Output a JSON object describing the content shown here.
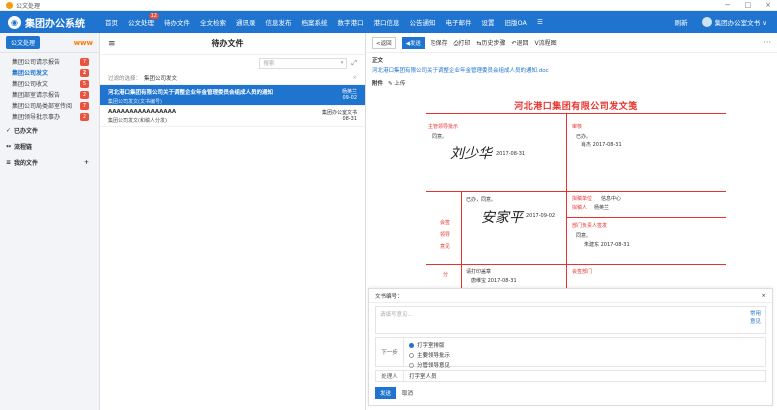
{
  "window": {
    "title": "公文处理",
    "minimize": "−",
    "maximize": "□",
    "close": "×"
  },
  "brand": {
    "name": "集团办公系统"
  },
  "nav": {
    "items": [
      "首页",
      "公文处理",
      "待办文件",
      "全文检索",
      "通讯录",
      "信息发布",
      "档案系统",
      "数字港口",
      "港口信息",
      "公告通知",
      "电子邮件",
      "设置",
      "旧版OA",
      "☰"
    ],
    "badge": "12",
    "refresh": "刷新",
    "user": "集团办公室文书 ∨"
  },
  "sidebar": {
    "pill": "公文处理",
    "watermark": "www",
    "items": [
      {
        "label": "集团公司请示报告",
        "count": "7"
      },
      {
        "label": "集团公司发文",
        "count": "2"
      },
      {
        "label": "集团公司收文",
        "count": "5"
      },
      {
        "label": "集团部室请示报告",
        "count": "2"
      },
      {
        "label": "集团公司局类部室传阅",
        "count": "7"
      },
      {
        "label": "集团领导批示事办",
        "count": "2"
      }
    ],
    "groups": [
      {
        "icon": "✓",
        "label": "已办文件",
        "extra": ""
      },
      {
        "icon": "↔",
        "label": "流程链",
        "extra": ""
      },
      {
        "icon": "≡",
        "label": "我的文件",
        "extra": "+"
      }
    ]
  },
  "list": {
    "menu_icon": "≡",
    "title": "待办文件",
    "search_placeholder": "搜索",
    "expand": "⤢",
    "filter_label": "过滤的选择：",
    "filter_value": "集团公司发文",
    "filter_close": "×",
    "rows": [
      {
        "title": "河北港口集团有限公司关于调整企业年金管理委员会组成人员的通知",
        "sub": "集团公司发文(文书编号)",
        "right1": "杨英兰",
        "right2": "09-02"
      },
      {
        "title": "AAAAAAAAAAAAAAAA",
        "sub": "集团公司发文(和稿人分发)",
        "right1": "集团办公室文书",
        "right2": "08-31"
      }
    ]
  },
  "detail": {
    "toolbar": {
      "back": "<返回",
      "send": "◀发送",
      "save": "⎘保存",
      "print": "⎙打印",
      "history": "⇆历史步骤",
      "return": "↶退回",
      "flow": "Ⅴ流程图",
      "more": "···"
    },
    "section": "正文",
    "doc_link": "河北港口集团有限公司关于调整企业年金管理委员会组成人员的通知.doc",
    "attach_label": "附件",
    "upload": "✎ 上传",
    "doc": {
      "title": "河北港口集团有限公司发文笺",
      "c1_label": "主管领导批示",
      "c1_text": "同意。",
      "c1_sig": "刘少华",
      "c1_date": "2017-08-31",
      "c2_label": "审核",
      "c2_text": "已办。",
      "c2_date": "肖杰 2017-08-31",
      "c3_text": "已办，同意。",
      "c3_sig": "安家平",
      "c3_date": "2017-09-02",
      "c3_side1": "会签",
      "c3_side2": "领导",
      "c3_side3": "意见",
      "c4_label": "拟稿单位",
      "c4_val": "信息中心",
      "c4_label2": "拟稿人",
      "c4_val2": "杨英兰",
      "c5_label": "部门负责人签发",
      "c5_text": "同意。",
      "c5_date": "朱建东 2017-08-31",
      "c6_side": "分",
      "c6_text": "请打印盖章",
      "c6_date": "唐维宝 2017-08-31",
      "c7_label": "会签部门"
    }
  },
  "panel": {
    "title": "文书编号：",
    "close": "×",
    "opinion_placeholder": "请填写意见...",
    "common": "常用",
    "opinion": "意见",
    "next_label": "下一步",
    "options": [
      "打字室排版",
      "主要领导批示",
      "分管领导意见"
    ],
    "handler_label": "处理人",
    "handler_value": "打字室人员",
    "send": "发送",
    "cancel": "取消"
  }
}
